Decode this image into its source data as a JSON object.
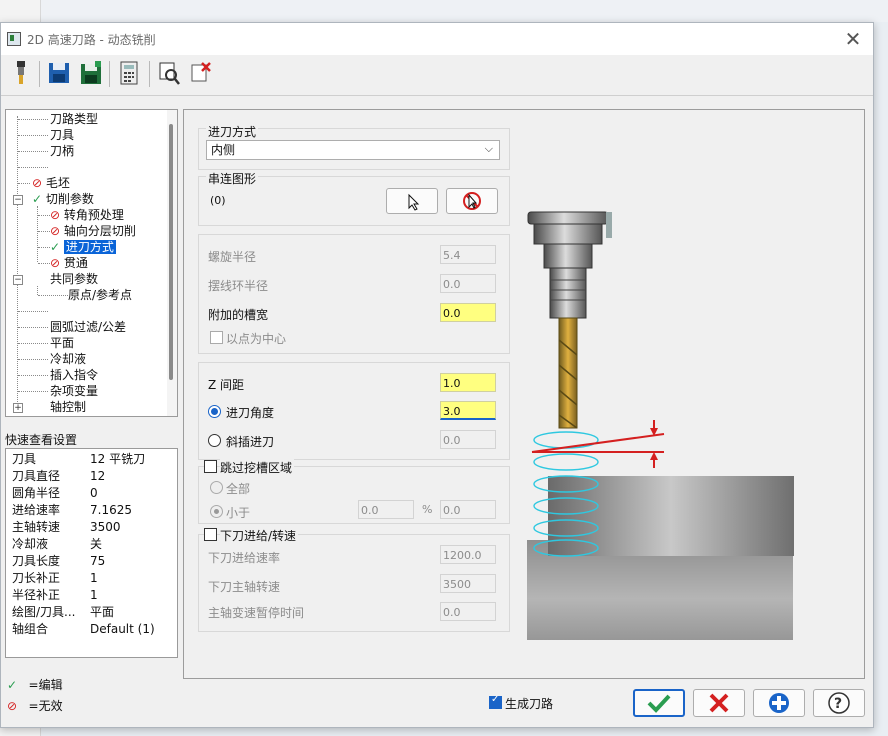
{
  "window": {
    "title": "2D 高速刀路 - 动态铣削"
  },
  "colors": {
    "accent": "#1a64c8",
    "highlight_field": "#ffff80",
    "helix": "#2ec8e0",
    "entry_red": "#d42020"
  },
  "toolbar": {
    "icons": [
      "tool-icon",
      "save-icon",
      "save-all-icon",
      "calculator-icon",
      "preview-icon",
      "clear-icon"
    ]
  },
  "tree": {
    "items": [
      {
        "label": "刀路类型"
      },
      {
        "label": "刀具"
      },
      {
        "label": "刀柄"
      },
      {
        "label": ""
      },
      {
        "label": "毛坯",
        "status": "invalid"
      },
      {
        "label": "切削参数",
        "status": "edited"
      },
      {
        "label": "转角预处理",
        "status": "invalid"
      },
      {
        "label": "轴向分层切削",
        "status": "invalid"
      },
      {
        "label": "进刀方式",
        "status": "edited",
        "selected": true
      },
      {
        "label": "贯通",
        "status": "invalid"
      },
      {
        "label": "共同参数"
      },
      {
        "label": "原点/参考点"
      },
      {
        "label": ""
      },
      {
        "label": "圆弧过滤/公差"
      },
      {
        "label": "平面"
      },
      {
        "label": "冷却液"
      },
      {
        "label": "插入指令"
      },
      {
        "label": "杂项变量"
      },
      {
        "label": "轴控制"
      }
    ]
  },
  "quick_settings": {
    "title": "快速查看设置",
    "rows": [
      {
        "key": "刀具",
        "value": "12 平铣刀"
      },
      {
        "key": "刀具直径",
        "value": "12"
      },
      {
        "key": "圆角半径",
        "value": "0"
      },
      {
        "key": "进给速率",
        "value": "7.1625"
      },
      {
        "key": "主轴转速",
        "value": "3500"
      },
      {
        "key": "冷却液",
        "value": "关"
      },
      {
        "key": "刀具长度",
        "value": "75"
      },
      {
        "key": "刀长补正",
        "value": "1"
      },
      {
        "key": "半径补正",
        "value": "1"
      },
      {
        "key": "绘图/刀具...",
        "value": "平面"
      },
      {
        "key": "轴组合",
        "value": "Default (1)"
      }
    ]
  },
  "legend": {
    "edited": "=编辑",
    "invalid": "=无效"
  },
  "entry": {
    "method_label": "进刀方式",
    "method_value": "内侧",
    "chain_label": "串连图形",
    "chain_count": "(0)",
    "helix_radius_label": "螺旋半径",
    "helix_radius": "5.4",
    "trochoid_radius_label": "摆线环半径",
    "trochoid_radius": "0.0",
    "extra_slot_label": "附加的槽宽",
    "extra_slot": "0.0",
    "center_on_point_label": "以点为中心",
    "z_step_label": "Z 间距",
    "z_step": "1.0",
    "entry_angle_label": "进刀角度",
    "entry_angle": "3.0",
    "ramp_label": "斜插进刀",
    "ramp": "0.0",
    "skip_pocket_label": "跳过挖槽区域",
    "all_label": "全部",
    "less_than_label": "小于",
    "less_than_value": "0.0",
    "percent_sign": "%",
    "less_than_abs": "0.0",
    "plunge_label": "下刀进给/转速",
    "plunge_feed_label": "下刀进给速率",
    "plunge_feed": "1200.0",
    "plunge_spindle_label": "下刀主轴转速",
    "plunge_spindle": "3500",
    "dwell_label": "主轴变速暂停时间",
    "dwell": "0.0"
  },
  "footer": {
    "generate_toolpath_label": "生成刀路",
    "generate_toolpath_checked": true
  }
}
